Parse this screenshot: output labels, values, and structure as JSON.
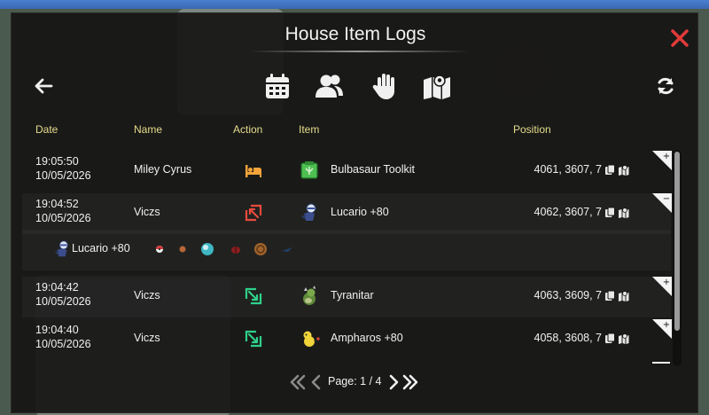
{
  "window": {
    "title": "House Item Logs"
  },
  "columns": {
    "date": "Date",
    "name": "Name",
    "action": "Action",
    "item": "Item",
    "position": "Position"
  },
  "colors": {
    "header": "#e6dc8c",
    "action_bed": "#f2a33a",
    "action_out": "#e84a3c",
    "action_in": "#2fd08a",
    "close": "#e23a3a"
  },
  "filters": [
    {
      "icon": "calendar-icon"
    },
    {
      "icon": "users-icon"
    },
    {
      "icon": "hand-icon"
    },
    {
      "icon": "map-icon"
    }
  ],
  "rows": [
    {
      "time": "19:05:50",
      "date": "10/05/2026",
      "name": "Miley Cyrus",
      "action_icon": "bed-icon",
      "item": "Bulbasaur Toolkit",
      "position": "4061, 3607, 7",
      "toggle": "+"
    },
    {
      "time": "19:04:52",
      "date": "10/05/2026",
      "name": "Viczs",
      "action_icon": "arrow-out-icon",
      "item": "Lucario +80",
      "position": "4062, 3607, 7",
      "toggle": "−"
    },
    {
      "time": "19:04:42",
      "date": "10/05/2026",
      "name": "Viczs",
      "action_icon": "arrow-in-icon",
      "item": "Tyranitar",
      "position": "4063, 3609, 7",
      "toggle": "+"
    },
    {
      "time": "19:04:40",
      "date": "10/05/2026",
      "name": "Viczs",
      "action_icon": "arrow-in-icon",
      "item": "Ampharos +80",
      "position": "4058, 3608, 7",
      "toggle": "+"
    }
  ],
  "detail": {
    "label": "Lucario +80"
  },
  "pagination": {
    "label": "Page: 1 / 4"
  }
}
